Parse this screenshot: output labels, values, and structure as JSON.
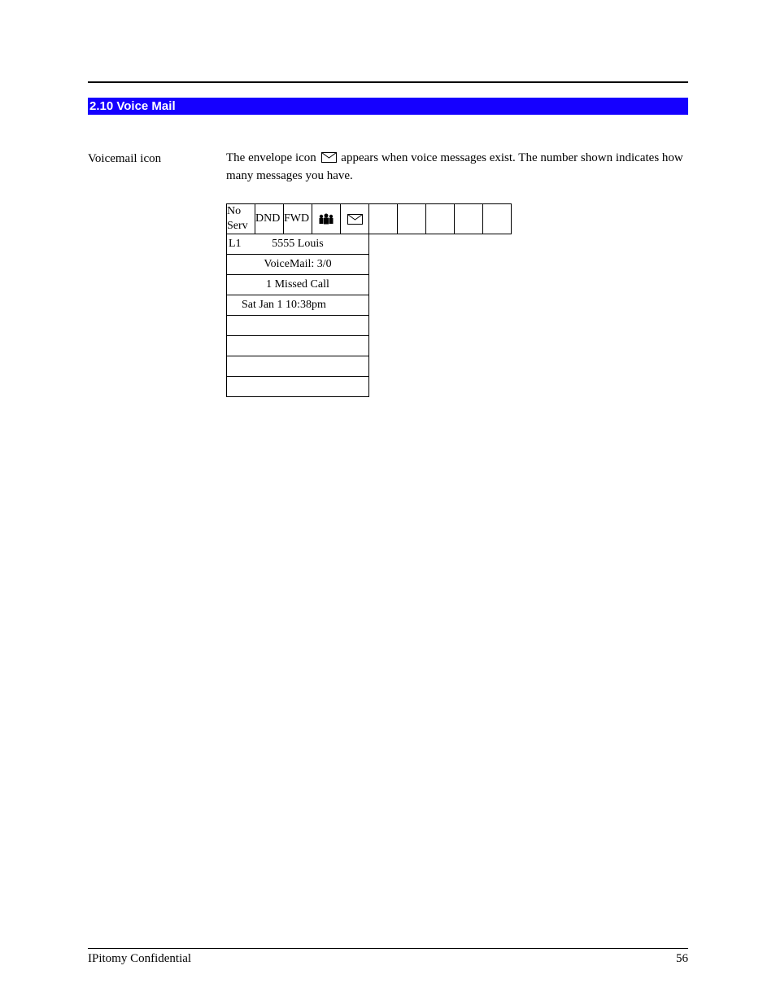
{
  "section_header": "2.10 Voice Mail",
  "left_label": "Voicemail icon",
  "desc_pre": "The envelope icon ",
  "desc_post": " appears when voice messages exist. The number shown indicates how many messages you have.",
  "display": {
    "status_row": {
      "c0": "No Serv",
      "c1": "DND",
      "c2": "FWD"
    },
    "line_row": {
      "label": "L1",
      "text": "5555  Louis"
    },
    "voicemail": "VoiceMail: 3/0",
    "missed": "1 Missed Call",
    "datetime": "Sat Jan 1 10:38pm"
  },
  "footer": {
    "left": "IPitomy Confidential",
    "right": "56"
  }
}
